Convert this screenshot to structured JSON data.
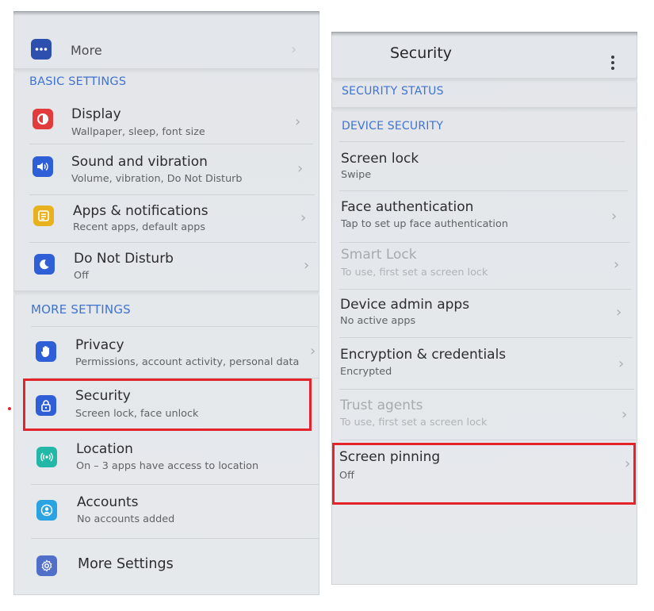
{
  "left": {
    "top_item": {
      "label": "More"
    },
    "basic_header": "BASIC SETTINGS",
    "basic_items": [
      {
        "title": "Display",
        "subtitle": "Wallpaper, sleep, font size",
        "icon": "display-icon",
        "color": "#e23b3b"
      },
      {
        "title": "Sound and vibration",
        "subtitle": "Volume, vibration, Do Not Disturb",
        "icon": "sound-icon",
        "color": "#2f5fd6"
      },
      {
        "title": "Apps & notifications",
        "subtitle": "Recent apps, default apps",
        "icon": "apps-icon",
        "color": "#e8b21e"
      },
      {
        "title": "Do Not Disturb",
        "subtitle": "Off",
        "icon": "moon-icon",
        "color": "#2f5fd6"
      }
    ],
    "more_header": "MORE SETTINGS",
    "more_items": [
      {
        "title": "Privacy",
        "subtitle": "Permissions, account activity, personal data",
        "icon": "hand-icon",
        "color": "#2f5fd6"
      },
      {
        "title": "Security",
        "subtitle": "Screen lock, face unlock",
        "icon": "lock-icon",
        "color": "#2f5fd6"
      },
      {
        "title": "Location",
        "subtitle": "On – 3 apps have access to location",
        "icon": "location-icon",
        "color": "#22b7a6"
      },
      {
        "title": "Accounts",
        "subtitle": "No accounts added",
        "icon": "account-icon",
        "color": "#2aa3e0"
      },
      {
        "title": "More Settings",
        "subtitle": "",
        "icon": "gear-icon",
        "color": "#4f6fc9"
      }
    ]
  },
  "right": {
    "page_title": "Security",
    "status_header": "SECURITY STATUS",
    "device_header": "DEVICE SECURITY",
    "items": [
      {
        "title": "Screen lock",
        "subtitle": "Swipe",
        "disabled": false
      },
      {
        "title": "Face authentication",
        "subtitle": "Tap to set up face authentication",
        "disabled": false
      },
      {
        "title": "Smart Lock",
        "subtitle": "To use, first set a screen lock",
        "disabled": true
      },
      {
        "title": "Device admin apps",
        "subtitle": "No active apps",
        "disabled": false
      },
      {
        "title": "Encryption & credentials",
        "subtitle": "Encrypted",
        "disabled": false
      },
      {
        "title": "Trust agents",
        "subtitle": "To use, first set a screen lock",
        "disabled": true
      },
      {
        "title": "Screen pinning",
        "subtitle": "Off",
        "disabled": false
      }
    ]
  },
  "colors": {
    "accent": "#3f73d2",
    "highlight": "#e3242b"
  }
}
